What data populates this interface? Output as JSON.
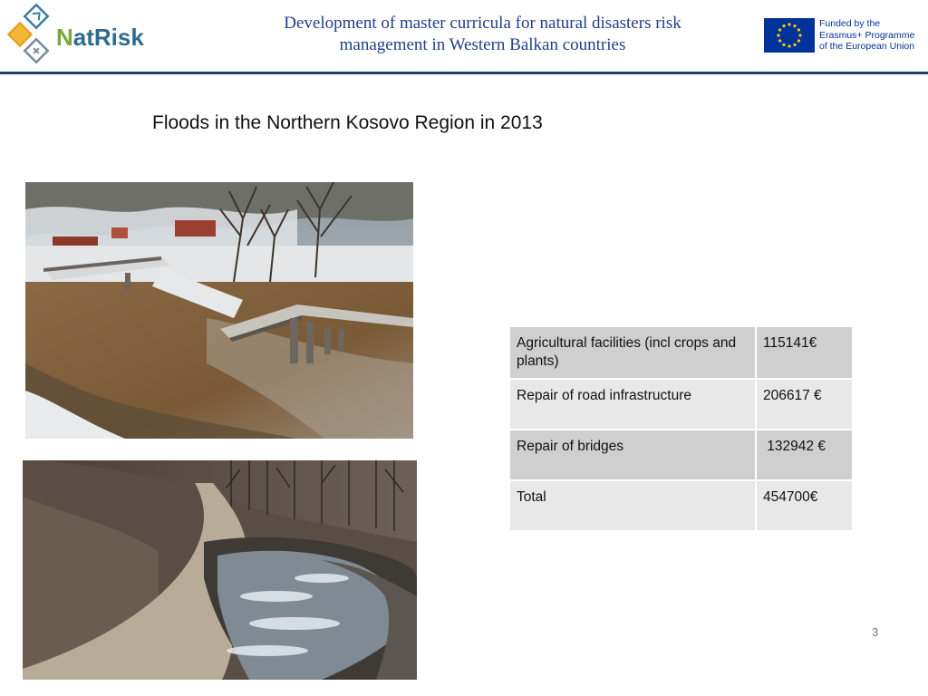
{
  "header": {
    "logo": {
      "name": "natrisk-logo",
      "text_n": "N",
      "text_rest": "atRisk"
    },
    "title_line1": "Development of master curricula for natural disasters risk",
    "title_line2": "management in Western Balkan countries",
    "eu": {
      "line1": "Funded by the",
      "line2": "Erasmus+ Programme",
      "line3": "of the European Union",
      "flag_color": "#003399",
      "star_color": "#ffcc00"
    },
    "rule_color": "#1f3f66"
  },
  "slide": {
    "title": "Floods in the Northern Kosovo Region in 2013",
    "page_number": "3"
  },
  "photos": [
    {
      "name": "collapsed-bridge-flood-photo"
    },
    {
      "name": "damaged-road-river-photo"
    }
  ],
  "table": {
    "rows": [
      {
        "item": "Agricultural facilities (incl crops and plants)",
        "cost": "115141€"
      },
      {
        "item": "Repair of road infrastructure",
        "cost": "206617 €"
      },
      {
        "item": "Repair of bridges",
        "cost": " 132942 €"
      },
      {
        "item": "Total",
        "cost": "454700€"
      }
    ]
  }
}
